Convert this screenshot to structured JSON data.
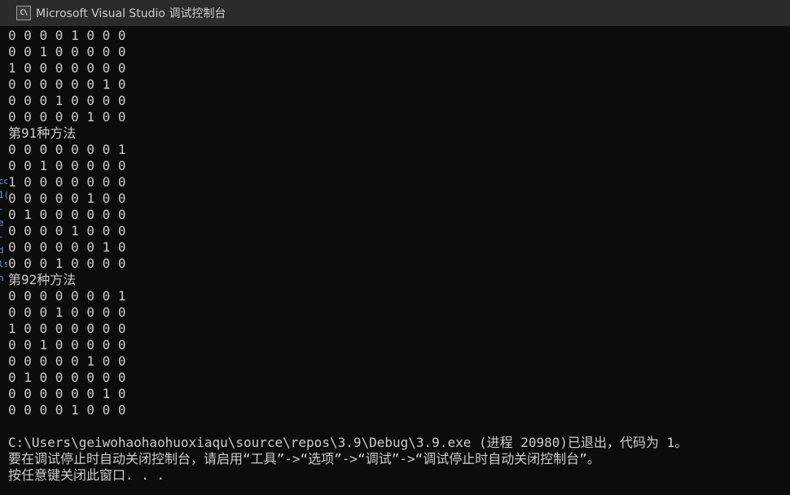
{
  "window": {
    "title": "Microsoft Visual Studio 调试控制台",
    "icon": "C\\"
  },
  "console": {
    "lines": [
      "0 0 0 0 1 0 0 0",
      "0 0 1 0 0 0 0 0",
      "1 0 0 0 0 0 0 0",
      "0 0 0 0 0 0 1 0",
      "0 0 0 1 0 0 0 0",
      "0 0 0 0 0 1 0 0",
      "第91种方法",
      "0 0 0 0 0 0 0 1",
      "0 0 1 0 0 0 0 0",
      "1 0 0 0 0 0 0 0",
      "0 0 0 0 0 1 0 0",
      "0 1 0 0 0 0 0 0",
      "0 0 0 0 1 0 0 0",
      "0 0 0 0 0 0 1 0",
      "0 0 0 1 0 0 0 0",
      "第92种方法",
      "0 0 0 0 0 0 0 1",
      "0 0 0 1 0 0 0 0",
      "1 0 0 0 0 0 0 0",
      "0 0 1 0 0 0 0 0",
      "0 0 0 0 0 1 0 0",
      "0 1 0 0 0 0 0 0",
      "0 0 0 0 0 0 1 0",
      "0 0 0 0 1 0 0 0",
      "",
      "C:\\Users\\geiwohaohaohuoxiaqu\\source\\repos\\3.9\\Debug\\3.9.exe (进程 20980)已退出，代码为 1。",
      "要在调试停止时自动关闭控制台，请启用“工具”->“选项”->“调试”->“调试停止时自动关闭控制台”。",
      "按任意键关闭此窗口. . ."
    ]
  },
  "background_fragments": [
    "co",
    "1(",
    "-",
    "e",
    "-",
    "d",
    "ls",
    "n"
  ],
  "colors": {
    "console_bg": "#0c0c0c",
    "console_text": "#cccccc",
    "titlebar_bg": "#2b2b2b"
  }
}
